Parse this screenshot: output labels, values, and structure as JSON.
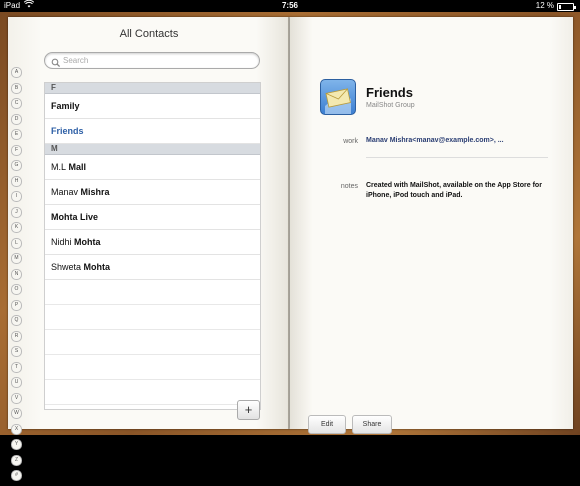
{
  "status_bar": {
    "carrier": "iPad",
    "time": "7:56",
    "battery": "12 %",
    "battery_level": 0.12
  },
  "left_page": {
    "title": "All Contacts",
    "search_placeholder": "Search",
    "index_letters": [
      "A",
      "B",
      "C",
      "D",
      "E",
      "F",
      "G",
      "H",
      "I",
      "J",
      "K",
      "L",
      "M",
      "N",
      "O",
      "P",
      "Q",
      "R",
      "S",
      "T",
      "U",
      "V",
      "W",
      "X",
      "Y",
      "Z",
      "#"
    ],
    "sections": [
      {
        "header": "F",
        "rows": [
          {
            "first": "Family",
            "last": "",
            "selected": false
          },
          {
            "first": "Friends",
            "last": "",
            "selected": true
          }
        ]
      },
      {
        "header": "M",
        "rows": [
          {
            "first": "M.L",
            "last": "Mall",
            "selected": false
          },
          {
            "first": "Manav",
            "last": "Mishra",
            "selected": false
          },
          {
            "first": "",
            "last": "Mohta Live",
            "selected": false
          },
          {
            "first": "Nidhi",
            "last": "Mohta",
            "selected": false
          },
          {
            "first": "Shweta",
            "last": "Mohta",
            "selected": false
          }
        ]
      }
    ],
    "add_button": "+"
  },
  "right_page": {
    "contact_name": "Friends",
    "contact_subtitle": "MailShot Group",
    "work_label": "work",
    "work_value": "Manav Mishra<manav@example.com>, ...",
    "notes_label": "notes",
    "notes_value": "Created with MailShot, available on the App Store for iPhone, iPod touch and iPad.",
    "edit_button": "Edit",
    "share_button": "Share"
  },
  "colors": {
    "selected_text": "#2d5fa6",
    "book_cover": "#a86d33",
    "paper": "#fbfaf6"
  }
}
